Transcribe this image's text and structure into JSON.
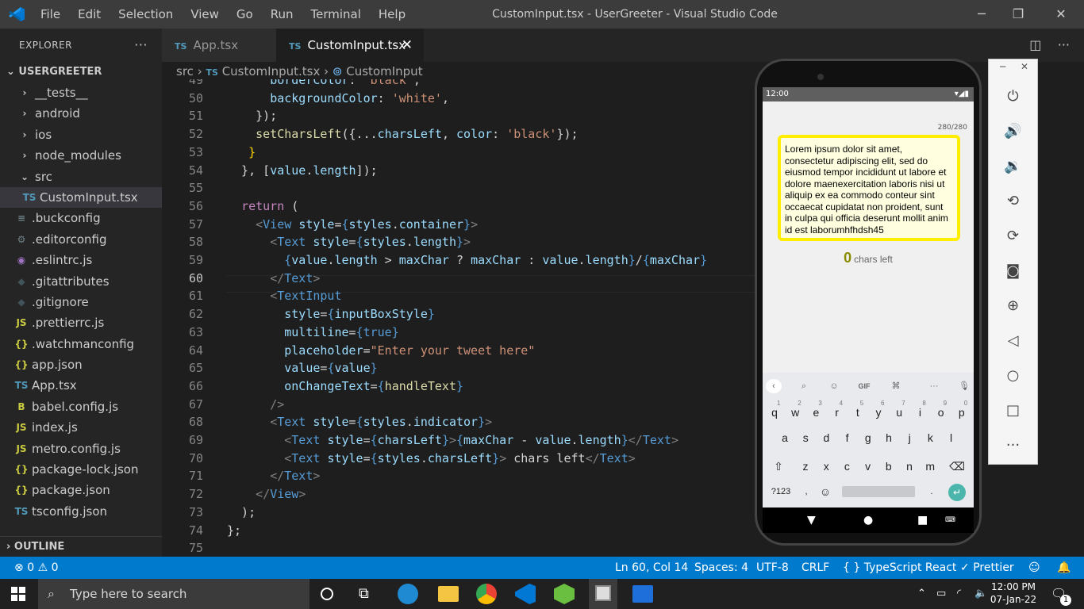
{
  "window": {
    "title": "CustomInput.tsx - UserGreeter - Visual Studio Code"
  },
  "menu": [
    "File",
    "Edit",
    "Selection",
    "View",
    "Go",
    "Run",
    "Terminal",
    "Help"
  ],
  "explorer": {
    "header": "EXPLORER",
    "root": "USERGREETER",
    "items": [
      {
        "icon": "›",
        "label": "__tests__"
      },
      {
        "icon": "›",
        "label": "android"
      },
      {
        "icon": "›",
        "label": "ios"
      },
      {
        "icon": "›",
        "label": "node_modules"
      },
      {
        "icon": "⌄",
        "label": "src"
      },
      {
        "icon": "TS",
        "label": "CustomInput.tsx"
      },
      {
        "icon": "≡",
        "label": ".buckconfig"
      },
      {
        "icon": "⚙",
        "label": ".editorconfig"
      },
      {
        "icon": "◉",
        "label": ".eslintrc.js"
      },
      {
        "icon": "◆",
        "label": ".gitattributes"
      },
      {
        "icon": "◆",
        "label": ".gitignore"
      },
      {
        "icon": "JS",
        "label": ".prettierrc.js"
      },
      {
        "icon": "{}",
        "label": ".watchmanconfig"
      },
      {
        "icon": "{}",
        "label": "app.json"
      },
      {
        "icon": "TS",
        "label": "App.tsx"
      },
      {
        "icon": "B",
        "label": "babel.config.js"
      },
      {
        "icon": "JS",
        "label": "index.js"
      },
      {
        "icon": "JS",
        "label": "metro.config.js"
      },
      {
        "icon": "{}",
        "label": "package-lock.json"
      },
      {
        "icon": "{}",
        "label": "package.json"
      },
      {
        "icon": "TS",
        "label": "tsconfig.json"
      }
    ],
    "outline": "OUTLINE"
  },
  "tabs": [
    {
      "prefix": "TS",
      "label": "App.tsx"
    },
    {
      "prefix": "TS",
      "label": "CustomInput.tsx"
    }
  ],
  "breadcrumb": {
    "folder": "src",
    "file_prefix": "TS",
    "file": "CustomInput.tsx",
    "symbol": "CustomInput"
  },
  "code": {
    "current_line": 60,
    "lines": [
      {
        "n": "49"
      },
      {
        "n": "50"
      },
      {
        "n": "51"
      },
      {
        "n": "52"
      },
      {
        "n": "53"
      },
      {
        "n": "54"
      },
      {
        "n": "55"
      },
      {
        "n": "56"
      },
      {
        "n": "57"
      },
      {
        "n": "58"
      },
      {
        "n": "59"
      },
      {
        "n": "60"
      },
      {
        "n": "61"
      },
      {
        "n": "62"
      },
      {
        "n": "63"
      },
      {
        "n": "64"
      },
      {
        "n": "65"
      },
      {
        "n": "66"
      },
      {
        "n": "67"
      },
      {
        "n": "68"
      },
      {
        "n": "69"
      },
      {
        "n": "70"
      },
      {
        "n": "71"
      },
      {
        "n": "72"
      },
      {
        "n": "73"
      },
      {
        "n": "74"
      },
      {
        "n": "75"
      }
    ]
  },
  "statusbar": {
    "errors": "0",
    "warnings": "0",
    "position": "Ln 60, Col 14",
    "spaces": "Spaces: 4",
    "encoding": "UTF-8",
    "eol": "CRLF",
    "language": "TypeScript React",
    "formatter": "Prettier"
  },
  "phone": {
    "time": "12:00",
    "counter": "280/280",
    "text": "Lorem ipsum dolor sit amet, consectetur adipiscing elit, sed do eiusmod tempor incididunt ut labore et dolore maenexercitation laboris nisi ut aliquip ex ea commodo conteur sint occaecat cupidatat non proident, sunt in culpa qui officia deserunt mollit anim id est laborumhfhdsh45",
    "chars_left_num": "0",
    "chars_left_label": "chars left",
    "keyboard": {
      "row1": [
        "q",
        "w",
        "e",
        "r",
        "t",
        "y",
        "u",
        "i",
        "o",
        "p"
      ],
      "row1_hints": [
        "1",
        "2",
        "3",
        "4",
        "5",
        "6",
        "7",
        "8",
        "9",
        "0"
      ],
      "row2": [
        "a",
        "s",
        "d",
        "f",
        "g",
        "h",
        "j",
        "k",
        "l"
      ],
      "row3": [
        "z",
        "x",
        "c",
        "v",
        "b",
        "n",
        "m"
      ],
      "symbols": "?123",
      "gif": "GIF"
    }
  },
  "taskbar": {
    "search_placeholder": "Type here to search",
    "time": "12:00 PM",
    "date": "07-Jan-22",
    "notifications": "1"
  },
  "colors": {
    "accent": "#007acc",
    "titlebar": "#3c3c3c",
    "sidebar": "#252526",
    "editor": "#1e1e1e"
  }
}
